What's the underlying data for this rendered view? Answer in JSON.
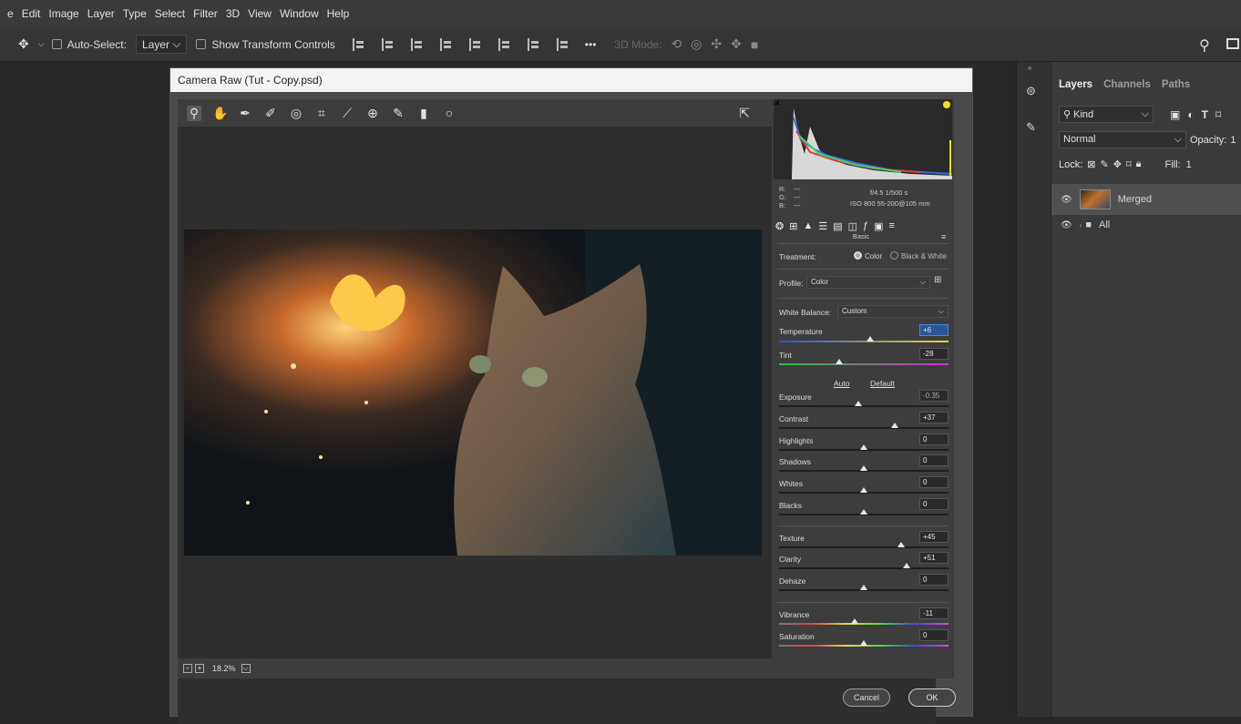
{
  "menu": {
    "items": [
      "e",
      "Edit",
      "Image",
      "Layer",
      "Type",
      "Select",
      "Filter",
      "3D",
      "View",
      "Window",
      "Help"
    ]
  },
  "options_bar": {
    "auto_select_label": "Auto-Select:",
    "auto_select_target": "Layer",
    "show_transform_label": "Show Transform Controls",
    "more_label": "•••",
    "mode_3d_label": "3D Mode:"
  },
  "dialog": {
    "title": "Camera Raw (Tut - Copy.psd)",
    "zoom": "18.2%",
    "histogram_info": {
      "r": "R:",
      "g": "G:",
      "b": "B:",
      "dash": "---",
      "aperture_shutter": "f/4.5  1/500 s",
      "iso_lens": "ISO 800  55-200@105 mm"
    },
    "panel_name": "Basic",
    "treatment_label": "Treatment:",
    "treatment_color": "Color",
    "treatment_bw": "Black & White",
    "profile_label": "Profile:",
    "profile_value": "Color",
    "wb_label": "White Balance:",
    "wb_value": "Custom",
    "auto_label": "Auto",
    "default_label": "Default",
    "sliders": [
      {
        "label": "Temperature",
        "value": "+6"
      },
      {
        "label": "Tint",
        "value": "-28"
      },
      {
        "label": "Exposure",
        "value": "-0.35"
      },
      {
        "label": "Contrast",
        "value": "+37"
      },
      {
        "label": "Highlights",
        "value": "0"
      },
      {
        "label": "Shadows",
        "value": "0"
      },
      {
        "label": "Whites",
        "value": "0"
      },
      {
        "label": "Blacks",
        "value": "0"
      },
      {
        "label": "Texture",
        "value": "+45"
      },
      {
        "label": "Clarity",
        "value": "+51"
      },
      {
        "label": "Dehaze",
        "value": "0"
      },
      {
        "label": "Vibrance",
        "value": "-11"
      },
      {
        "label": "Saturation",
        "value": "0"
      }
    ],
    "cancel_label": "Cancel",
    "ok_label": "OK"
  },
  "layers_panel": {
    "tabs": [
      "Layers",
      "Channels",
      "Paths"
    ],
    "kind_label": "Kind",
    "blend_mode": "Normal",
    "opacity_label": "Opacity:",
    "opacity_value": "1",
    "lock_label": "Lock:",
    "fill_label": "Fill:",
    "fill_value": "1",
    "layers": [
      {
        "name": "Merged"
      },
      {
        "name": "All"
      }
    ]
  }
}
